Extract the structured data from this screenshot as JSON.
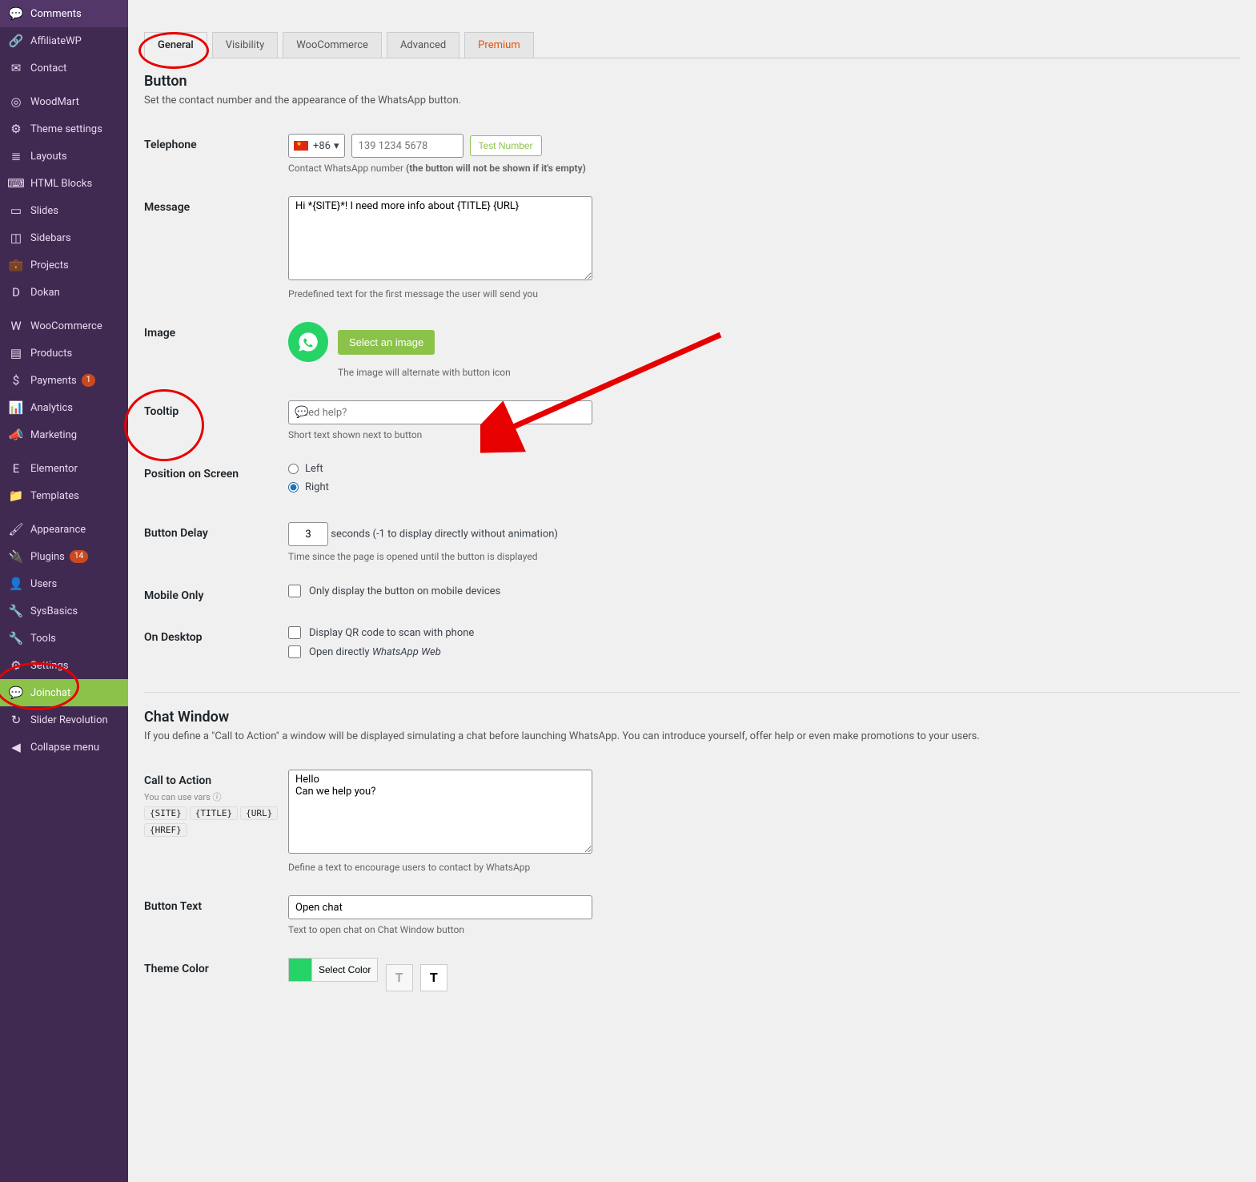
{
  "sidebar": {
    "items": [
      {
        "label": "Comments",
        "icon": "💬"
      },
      {
        "label": "AffiliateWP",
        "icon": "🔗"
      },
      {
        "label": "Contact",
        "icon": "✉"
      },
      {
        "label": "WoodMart",
        "icon": "◎",
        "sep_before": true
      },
      {
        "label": "Theme settings",
        "icon": "⚙"
      },
      {
        "label": "Layouts",
        "icon": "≣"
      },
      {
        "label": "HTML Blocks",
        "icon": "⌨"
      },
      {
        "label": "Slides",
        "icon": "▭"
      },
      {
        "label": "Sidebars",
        "icon": "◫"
      },
      {
        "label": "Projects",
        "icon": "💼"
      },
      {
        "label": "Dokan",
        "icon": "D"
      },
      {
        "label": "WooCommerce",
        "icon": "W",
        "sep_before": true
      },
      {
        "label": "Products",
        "icon": "▤"
      },
      {
        "label": "Payments",
        "icon": "$",
        "badge": "1"
      },
      {
        "label": "Analytics",
        "icon": "📊"
      },
      {
        "label": "Marketing",
        "icon": "📣"
      },
      {
        "label": "Elementor",
        "icon": "E",
        "sep_before": true
      },
      {
        "label": "Templates",
        "icon": "📁"
      },
      {
        "label": "Appearance",
        "icon": "🖌",
        "sep_before": true
      },
      {
        "label": "Plugins",
        "icon": "🔌",
        "badge": "14"
      },
      {
        "label": "Users",
        "icon": "👤"
      },
      {
        "label": "SysBasics",
        "icon": "🔧"
      },
      {
        "label": "Tools",
        "icon": "🔧"
      },
      {
        "label": "Settings",
        "icon": "⚙"
      },
      {
        "label": "Joinchat",
        "icon": "💬",
        "active": true
      },
      {
        "label": "Slider Revolution",
        "icon": "↻"
      },
      {
        "label": "Collapse menu",
        "icon": "◀"
      }
    ]
  },
  "tabs": {
    "general": "General",
    "visibility": "Visibility",
    "woocommerce": "WooCommerce",
    "advanced": "Advanced",
    "premium": "Premium"
  },
  "button_section": {
    "title": "Button",
    "desc": "Set the contact number and the appearance of the WhatsApp button.",
    "telephone": {
      "label": "Telephone",
      "dial": "+86",
      "placeholder": "139 1234 5678",
      "test": "Test Number",
      "desc_pre": "Contact WhatsApp number ",
      "desc_bold": "(the button will not be shown if it's empty)"
    },
    "message": {
      "label": "Message",
      "value": "Hi *{SITE}*! I need more info about {TITLE} {URL}",
      "desc": "Predefined text for the first message the user will send you"
    },
    "image": {
      "label": "Image",
      "button": "Select an image",
      "desc": "The image will alternate with button icon"
    },
    "tooltip": {
      "label": "Tooltip",
      "placeholder": "Need help?",
      "desc": "Short text shown next to button"
    },
    "position": {
      "label": "Position on Screen",
      "left": "Left",
      "right": "Right"
    },
    "delay": {
      "label": "Button Delay",
      "value": "3",
      "suffix": " seconds (-1 to display directly without animation)",
      "desc": "Time since the page is opened until the button is displayed"
    },
    "mobile_only": {
      "label": "Mobile Only",
      "check": "Only display the button on mobile devices"
    },
    "desktop": {
      "label": "On Desktop",
      "qr": "Display QR code to scan with phone",
      "open_pre": "Open directly ",
      "open_em": "WhatsApp Web"
    }
  },
  "chat_section": {
    "title": "Chat Window",
    "desc": "If you define a \"Call to Action\" a window will be displayed simulating a chat before launching WhatsApp. You can introduce yourself, offer help or even make promotions to your users.",
    "cta": {
      "label": "Call to Action",
      "hint": "You can use vars ",
      "vars": [
        "{SITE}",
        "{TITLE}",
        "{URL}",
        "{HREF}"
      ],
      "value": "Hello\nCan we help you?",
      "desc": "Define a text to encourage users to contact by WhatsApp"
    },
    "button_text": {
      "label": "Button Text",
      "value": "Open chat",
      "desc": "Text to open chat on Chat Window button"
    },
    "theme": {
      "label": "Theme Color",
      "select": "Select Color"
    }
  }
}
